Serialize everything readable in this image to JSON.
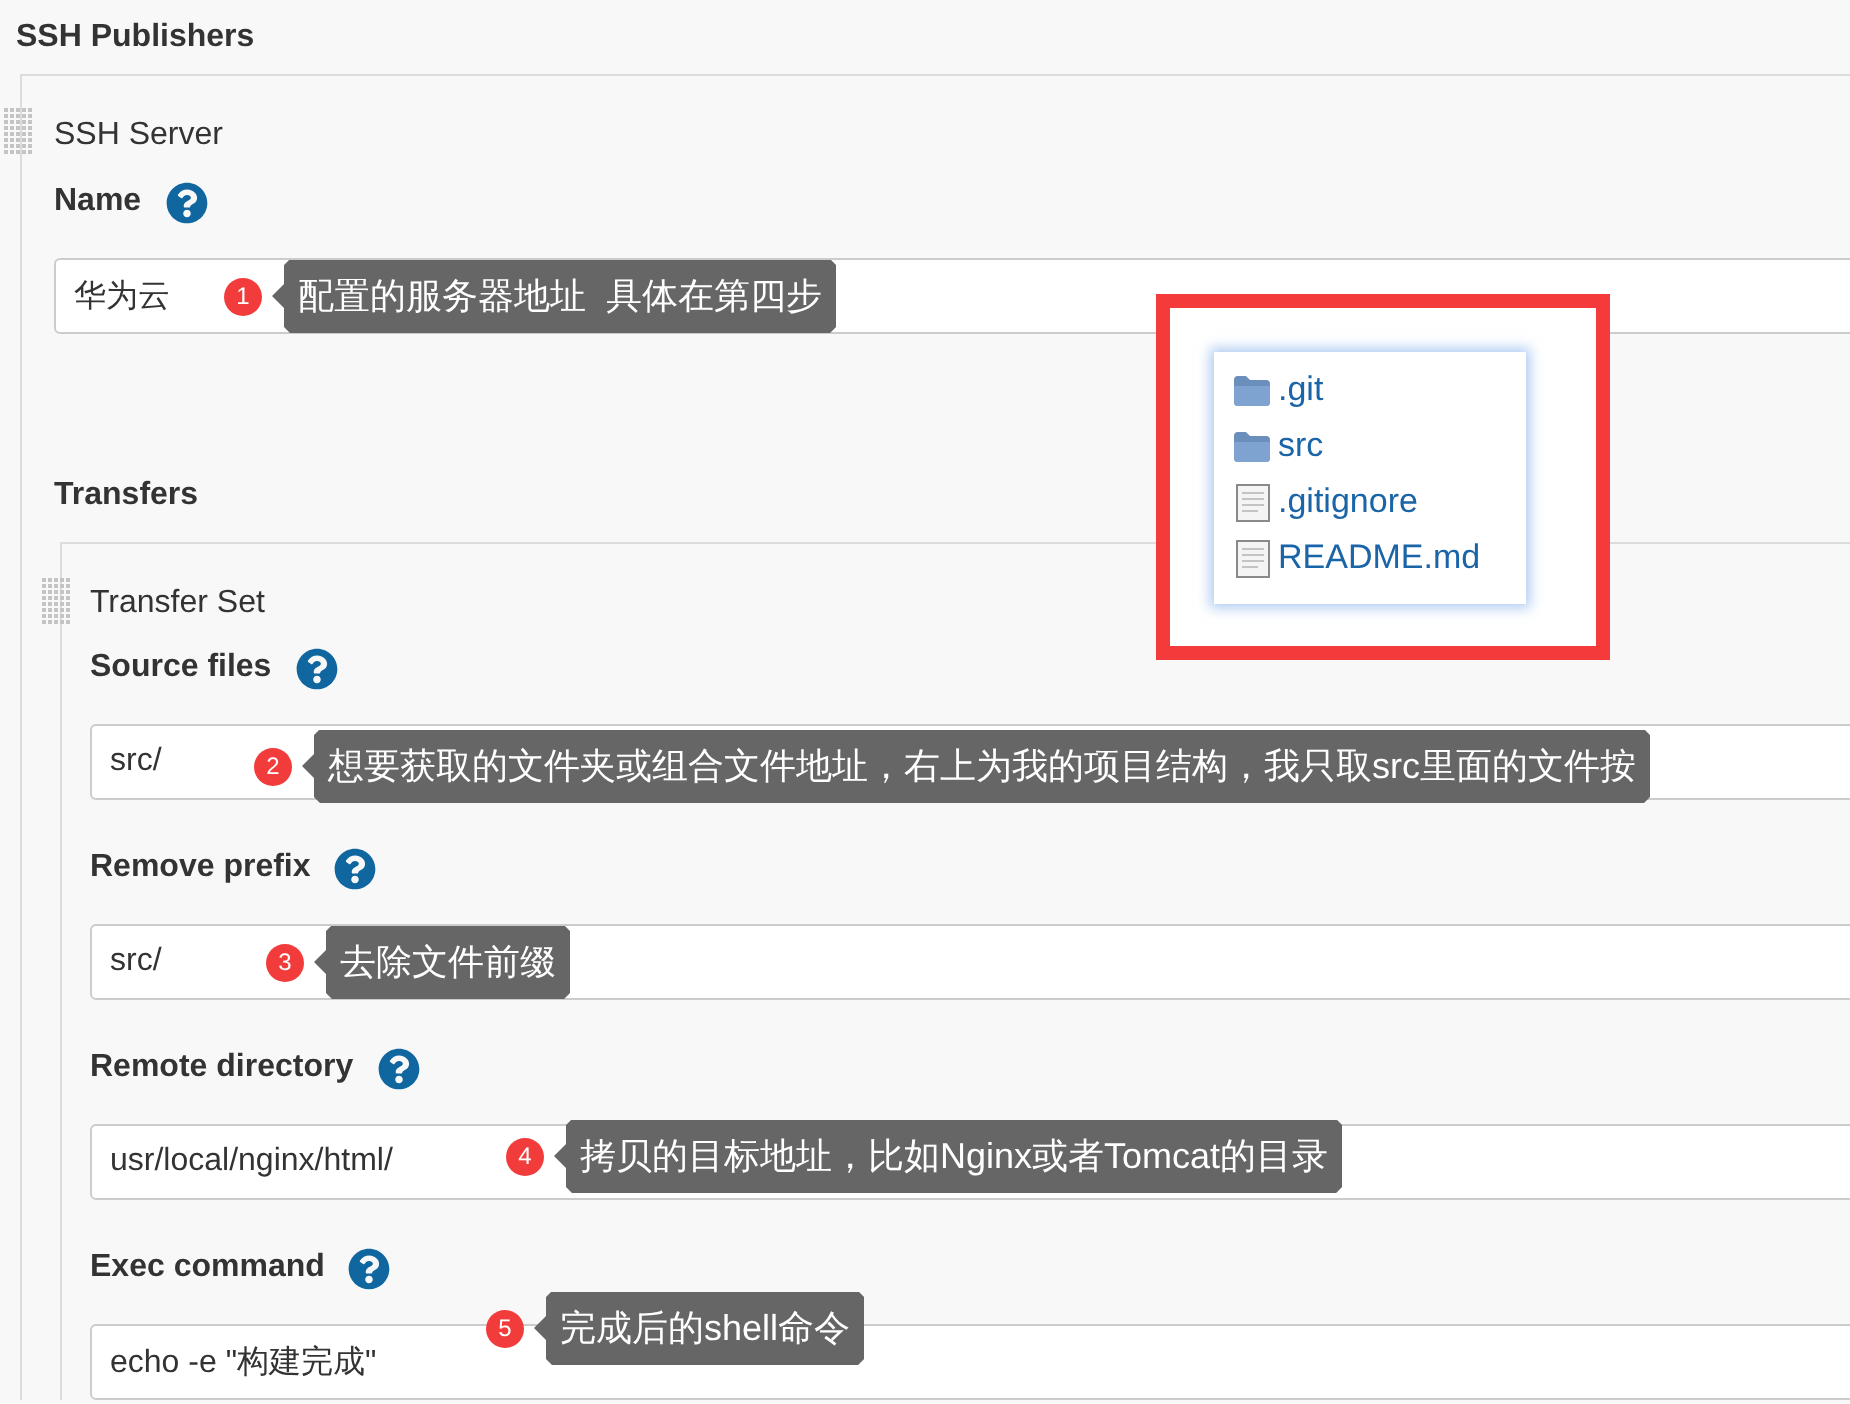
{
  "section": {
    "title": "SSH Publishers"
  },
  "server": {
    "title": "SSH Server",
    "fields": [
      {
        "label": "Name",
        "value": "华为云",
        "annotation": {
          "number": "1",
          "text": "配置的服务器地址  具体在第四步"
        }
      }
    ]
  },
  "transfers": {
    "title": "Transfers",
    "transfer_set": {
      "title": "Transfer Set",
      "fields": [
        {
          "label": "Source files",
          "value": "src/",
          "annotation": {
            "number": "2",
            "text": "想要获取的文件夹或组合文件地址，右上为我的项目结构，我只取src里面的文件按"
          }
        },
        {
          "label": "Remove prefix",
          "value": "src/",
          "annotation": {
            "number": "3",
            "text": "去除文件前缀"
          }
        },
        {
          "label": "Remote directory",
          "value": "usr/local/nginx/html/",
          "annotation": {
            "number": "4",
            "text": "拷贝的目标地址，比如Nginx或者Tomcat的目录"
          }
        },
        {
          "label": "Exec command",
          "value": "echo -e \"构建完成\"",
          "annotation": {
            "number": "5",
            "text": "完成后的shell命令"
          }
        }
      ]
    }
  },
  "project_structure": {
    "items": [
      {
        "kind": "folder",
        "name": ".git"
      },
      {
        "kind": "folder",
        "name": "src"
      },
      {
        "kind": "file",
        "name": ".gitignore"
      },
      {
        "kind": "file",
        "name": "README.md"
      }
    ]
  }
}
